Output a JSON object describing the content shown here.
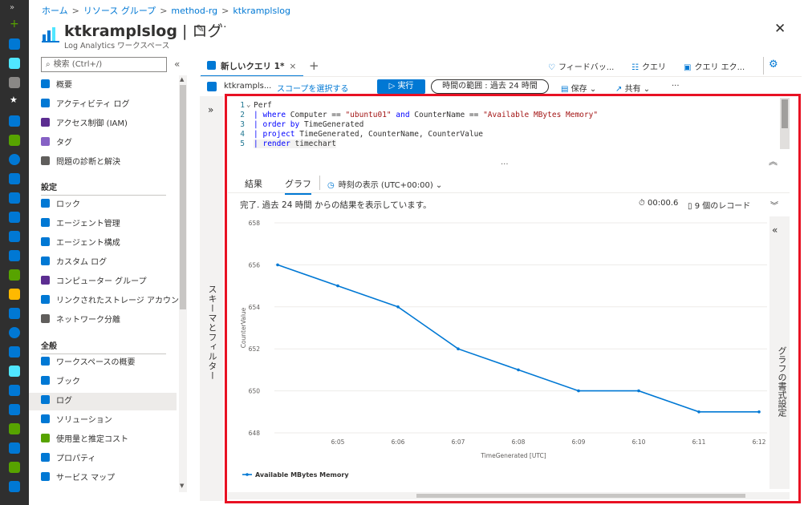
{
  "breadcrumb": [
    "ホーム",
    "リソース グループ",
    "method-rg",
    "ktkramplslog"
  ],
  "header": {
    "title": "ktkramplslog",
    "section": "ログ",
    "subtitle": "Log Analytics ワークスペース"
  },
  "sidebar": {
    "search_placeholder": "検索 (Ctrl+/)",
    "items_top": [
      {
        "label": "概要",
        "color": "#0078d4"
      },
      {
        "label": "アクティビティ ログ",
        "color": "#0078d4"
      },
      {
        "label": "アクセス制御 (IAM)",
        "color": "#5c2d91"
      },
      {
        "label": "タグ",
        "color": "#8661c5"
      },
      {
        "label": "問題の診断と解決",
        "color": "#605e5c"
      }
    ],
    "group_settings": "設定",
    "items_settings": [
      {
        "label": "ロック",
        "color": "#0078d4"
      },
      {
        "label": "エージェント管理",
        "color": "#0078d4"
      },
      {
        "label": "エージェント構成",
        "color": "#0078d4"
      },
      {
        "label": "カスタム ログ",
        "color": "#0078d4"
      },
      {
        "label": "コンピューター グループ",
        "color": "#5c2d91"
      },
      {
        "label": "リンクされたストレージ アカウント",
        "color": "#0078d4"
      },
      {
        "label": "ネットワーク分離",
        "color": "#605e5c"
      }
    ],
    "group_general": "全般",
    "items_general": [
      {
        "label": "ワークスペースの概要",
        "color": "#0078d4"
      },
      {
        "label": "ブック",
        "color": "#0078d4"
      },
      {
        "label": "ログ",
        "color": "#0078d4",
        "active": true
      },
      {
        "label": "ソリューション",
        "color": "#0078d4"
      },
      {
        "label": "使用量と推定コスト",
        "color": "#57a300"
      },
      {
        "label": "プロパティ",
        "color": "#0078d4"
      },
      {
        "label": "サービス マップ",
        "color": "#0078d4"
      }
    ]
  },
  "query_tab": {
    "title": "新しいクエリ 1*",
    "close": "×"
  },
  "toolbar": {
    "feedback": "フィードバッ...",
    "queries": "クエリ",
    "query_explorer": "クエリ エク..."
  },
  "actions": {
    "scope_name": "ktkrampls...",
    "scope_link": "スコープを選択する",
    "run": "実行",
    "time_range": "時間の範囲 : 過去 24 時間",
    "save": "保存",
    "share": "共有",
    "more": "···"
  },
  "schema_panel_label": "スキーマとフィルター",
  "editor": {
    "lines": [
      {
        "n": "1",
        "text": "Perf"
      },
      {
        "n": "2",
        "text": "| where Computer == \"ubuntu01\" and CounterName == \"Available MBytes Memory\""
      },
      {
        "n": "3",
        "text": "| order by TimeGenerated"
      },
      {
        "n": "4",
        "text": "| project TimeGenerated, CounterName, CounterValue"
      },
      {
        "n": "5",
        "text": "| render timechart"
      }
    ]
  },
  "results": {
    "tab_results": "結果",
    "tab_chart": "グラフ",
    "timezone": "時刻の表示 (UTC+00:00)",
    "status": "完了. 過去 24 時間 からの結果を表示しています。",
    "duration": "00:00.6",
    "records": "9 個のレコード"
  },
  "format_panel_label": "グラフの書式設定",
  "chart_data": {
    "type": "line",
    "xlabel": "TimeGenerated [UTC]",
    "ylabel": "CounterValue",
    "ylim": [
      648,
      658
    ],
    "yticks": [
      648,
      650,
      652,
      654,
      656,
      658
    ],
    "xticks": [
      "6:05",
      "6:06",
      "6:07",
      "6:08",
      "6:09",
      "6:10",
      "6:11",
      "6:12"
    ],
    "x": [
      "6:04",
      "6:05",
      "6:06",
      "6:07",
      "6:08",
      "6:09",
      "6:10",
      "6:11",
      "6:12"
    ],
    "series": [
      {
        "name": "Available MBytes Memory",
        "color": "#0078d4",
        "values": [
          656,
          655,
          654,
          652,
          651,
          650,
          650,
          649,
          649
        ]
      }
    ],
    "legend": "bottom-left"
  }
}
